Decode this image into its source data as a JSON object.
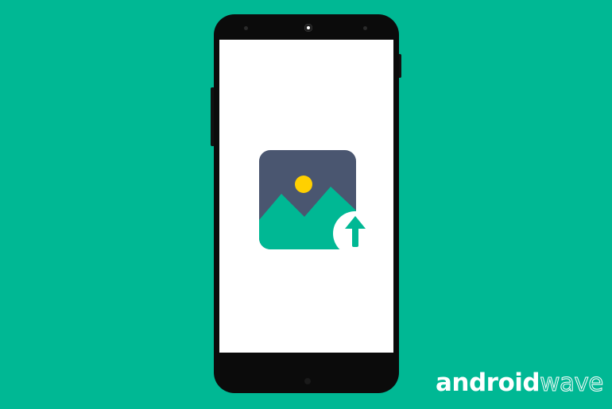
{
  "colors": {
    "background": "#00b894",
    "phone_body": "#0b0b0b",
    "screen": "#ffffff",
    "icon_frame": "#4a5670",
    "icon_mountain": "#00b894",
    "icon_sun": "#ffd000",
    "upload_badge": "#ffffff",
    "upload_arrow": "#00b894"
  },
  "icons": {
    "hero": "image-upload-icon",
    "arrow": "arrow-up-icon"
  },
  "brand": {
    "part1": "android",
    "part2": "wave"
  }
}
